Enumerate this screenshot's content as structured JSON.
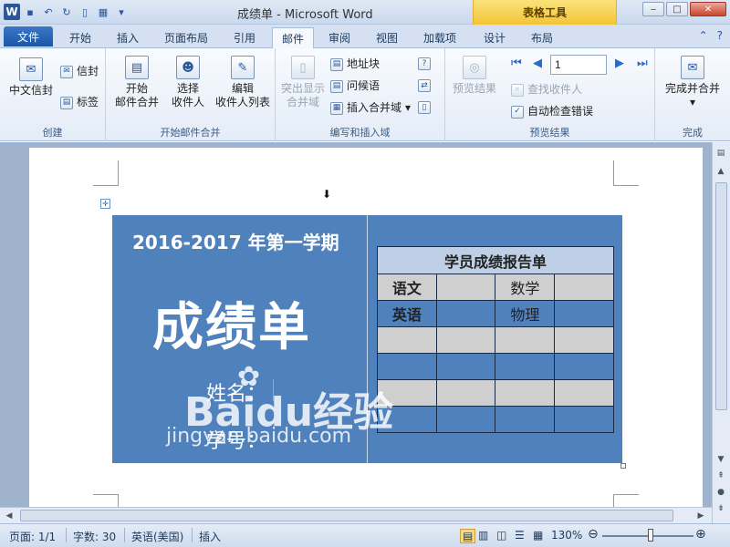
{
  "titlebar": {
    "title": "成绩单 - Microsoft Word",
    "context_tab_group": "表格工具",
    "app_icon": "W"
  },
  "tabs": [
    "文件",
    "开始",
    "插入",
    "页面布局",
    "引用",
    "邮件",
    "审阅",
    "视图",
    "加载项",
    "设计",
    "布局"
  ],
  "active_tab": "邮件",
  "ribbon": {
    "create": {
      "label": "创建",
      "chinese_envelope": "中文信封",
      "envelope": "信封",
      "label_btn": "标签"
    },
    "start_merge": {
      "label": "开始邮件合并",
      "start": "开始",
      "start_sub": "邮件合并",
      "select": "选择",
      "select_sub": "收件人",
      "edit": "编辑",
      "edit_sub": "收件人列表"
    },
    "write_insert": {
      "label": "编写和插入域",
      "highlight": "突出显示",
      "highlight_sub": "合并域",
      "address_block": "地址块",
      "greeting": "问候语",
      "insert_field": "插入合并域"
    },
    "preview": {
      "label": "预览结果",
      "preview_btn": "预览结果",
      "record": "1",
      "find_recipient": "查找收件人",
      "auto_check": "自动检查错误"
    },
    "finish": {
      "label": "完成",
      "finish_merge": "完成并合并"
    }
  },
  "document": {
    "term": "2016-2017 年第一学期",
    "title": "成绩单",
    "name_label": "姓名：",
    "id_label": "学号：",
    "report_title": "学员成绩报告单",
    "subjects": [
      "语文",
      "数学",
      "英语",
      "物理"
    ],
    "watermark_brand": "Baidu经验",
    "watermark_url": "jingyan.baidu.com"
  },
  "statusbar": {
    "page": "页面: 1/1",
    "words": "字数: 30",
    "language": "英语(美国)",
    "mode": "插入",
    "zoom": "130%"
  },
  "colors": {
    "certificate_bg": "#4f81bd",
    "context_tab": "#f3c536",
    "file_tab": "#1c56a5"
  }
}
